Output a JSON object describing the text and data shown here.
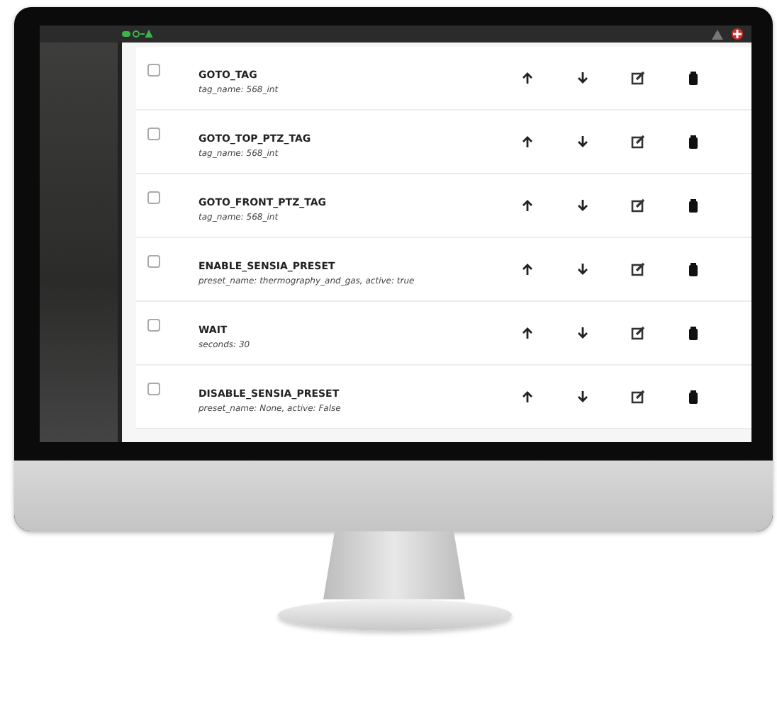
{
  "steps": [
    {
      "name": "GOTO_TAG",
      "params": "tag_name: 568_int",
      "checked": false
    },
    {
      "name": "GOTO_TOP_PTZ_TAG",
      "params": "tag_name: 568_int",
      "checked": false
    },
    {
      "name": "GOTO_FRONT_PTZ_TAG",
      "params": "tag_name: 568_int",
      "checked": false
    },
    {
      "name": "ENABLE_SENSIA_PRESET",
      "params": "preset_name: thermography_and_gas, active: true",
      "checked": false
    },
    {
      "name": "WAIT",
      "params": "seconds: 30",
      "checked": false
    },
    {
      "name": "DISABLE_SENSIA_PRESET",
      "params": "preset_name: None, active: False",
      "checked": false
    }
  ]
}
